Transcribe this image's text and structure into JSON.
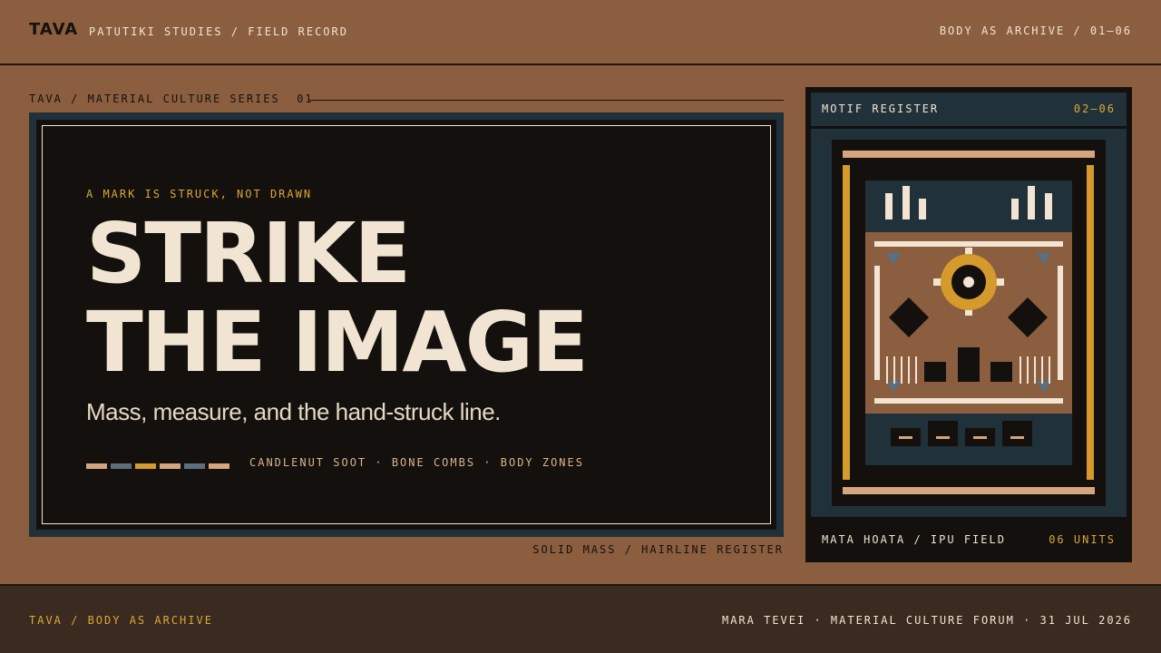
{
  "header": {
    "logo": "TAVA",
    "subtitle": "PATUTIKI STUDIES / FIELD RECORD",
    "section": "BODY AS ARCHIVE / 01–06"
  },
  "hero": {
    "series_label": "TAVA / MATERIAL CULTURE SERIES  01",
    "kicker": "A MARK IS STRUCK, NOT DRAWN",
    "headline_line1": "STRIKE",
    "headline_line2": "THE IMAGE",
    "lede": "Mass, measure, and the hand-struck line.",
    "materials": "CANDLENUT SOOT · BONE COMBS · BODY ZONES",
    "swatch_colors": [
      "#d4a57e",
      "#5b6f7c",
      "#d49a2c",
      "#d4a57e",
      "#5b6f7c",
      "#d4a57e"
    ],
    "caption": "SOLID MASS / HAIRLINE REGISTER"
  },
  "register": {
    "title": "MOTIF REGISTER",
    "code": "02–06",
    "footer_label": "MATA HOATA / IPU FIELD",
    "footer_count": "06 UNITS"
  },
  "footer": {
    "left": "TAVA / BODY AS ARCHIVE",
    "right": "MARA TEVEI · MATERIAL CULTURE FORUM · 31 JUL 2026"
  },
  "colors": {
    "ground": "#8b5e3f",
    "ink": "#13100d",
    "slate": "#213139",
    "bone": "#f1e4d2",
    "ochre": "#d9a836"
  }
}
